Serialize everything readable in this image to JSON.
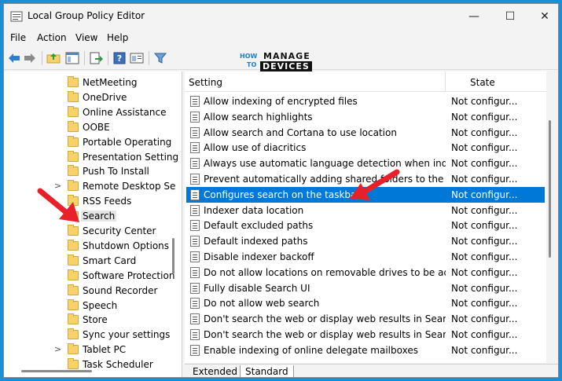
{
  "window": {
    "title": "Local Group Policy Editor"
  },
  "window_controls": {
    "minimize": "—",
    "maximize": "☐",
    "close": "✕"
  },
  "menu": [
    "File",
    "Action",
    "View",
    "Help"
  ],
  "logo": {
    "how": "HOW",
    "to": "TO",
    "manage": "MANAGE",
    "devices": "DEVICES"
  },
  "tree": {
    "items": [
      {
        "label": "NetMeeting",
        "expander": ""
      },
      {
        "label": "OneDrive",
        "expander": ""
      },
      {
        "label": "Online Assistance",
        "expander": ""
      },
      {
        "label": "OOBE",
        "expander": ""
      },
      {
        "label": "Portable Operating",
        "expander": ""
      },
      {
        "label": "Presentation Setting",
        "expander": ""
      },
      {
        "label": "Push To Install",
        "expander": ""
      },
      {
        "label": "Remote Desktop Se",
        "expander": ">"
      },
      {
        "label": "RSS Feeds",
        "expander": ""
      },
      {
        "label": "Search",
        "expander": "",
        "selected": true
      },
      {
        "label": "Security Center",
        "expander": ""
      },
      {
        "label": "Shutdown Options",
        "expander": ""
      },
      {
        "label": "Smart Card",
        "expander": ""
      },
      {
        "label": "Software Protection",
        "expander": ""
      },
      {
        "label": "Sound Recorder",
        "expander": ""
      },
      {
        "label": "Speech",
        "expander": ""
      },
      {
        "label": "Store",
        "expander": ""
      },
      {
        "label": "Sync your settings",
        "expander": ""
      },
      {
        "label": "Tablet PC",
        "expander": ">"
      },
      {
        "label": "Task Scheduler",
        "expander": ""
      }
    ]
  },
  "list": {
    "columns": {
      "setting": "Setting",
      "state": "State"
    },
    "rows": [
      {
        "setting": "Allow indexing of encrypted files",
        "state": "Not configur..."
      },
      {
        "setting": "Allow search highlights",
        "state": "Not configur..."
      },
      {
        "setting": "Allow search and Cortana to use location",
        "state": "Not configur..."
      },
      {
        "setting": "Allow use of diacritics",
        "state": "Not configur..."
      },
      {
        "setting": "Always use automatic language detection when indexi...",
        "state": "Not configur..."
      },
      {
        "setting": "Prevent automatically adding shared folders to the Wi...",
        "state": "Not configur..."
      },
      {
        "setting": "Configures search on the taskbar",
        "state": "Not configur...",
        "selected": true
      },
      {
        "setting": "Indexer data location",
        "state": "Not configur..."
      },
      {
        "setting": "Default excluded paths",
        "state": "Not configur..."
      },
      {
        "setting": "Default indexed paths",
        "state": "Not configur..."
      },
      {
        "setting": "Disable indexer backoff",
        "state": "Not configur..."
      },
      {
        "setting": "Do not allow locations on removable drives to be add...",
        "state": "Not configur..."
      },
      {
        "setting": "Fully disable Search UI",
        "state": "Not configur..."
      },
      {
        "setting": "Do not allow web search",
        "state": "Not configur..."
      },
      {
        "setting": "Don't search the web or display web results in Search",
        "state": "Not configur..."
      },
      {
        "setting": "Don't search the web or display web results in Search ...",
        "state": "Not configur..."
      },
      {
        "setting": "Enable indexing of online delegate mailboxes",
        "state": "Not configur..."
      }
    ]
  },
  "tabs": [
    "Extended",
    "Standard"
  ],
  "colors": {
    "selection": "#0078d7",
    "annotation_arrow": "#e8202a",
    "frame": "#1a8fd6"
  }
}
